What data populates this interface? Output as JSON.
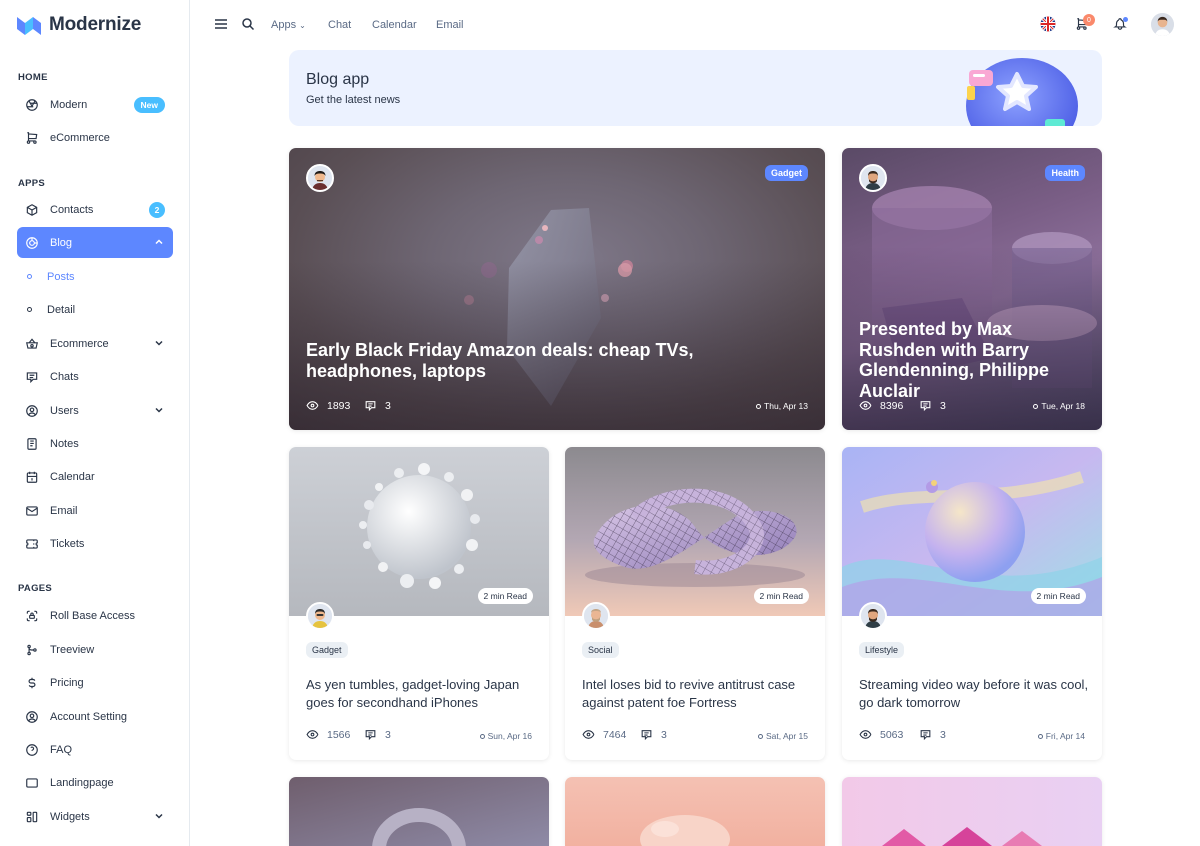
{
  "app": {
    "name": "Modernize"
  },
  "sidebar": {
    "sections": [
      "HOME",
      "APPS",
      "PAGES"
    ],
    "items": [
      {
        "label": "Modern",
        "icon": "aperture-icon",
        "badge": "New"
      },
      {
        "label": "eCommerce",
        "icon": "shopping-cart-icon"
      },
      {
        "label": "Contacts",
        "icon": "box-icon",
        "badge": "2"
      },
      {
        "label": "Blog",
        "icon": "chart-donut-icon",
        "active": true
      },
      {
        "label": "Posts",
        "sub": true,
        "current": true
      },
      {
        "label": "Detail",
        "sub": true
      },
      {
        "label": "Ecommerce",
        "icon": "basket-icon"
      },
      {
        "label": "Chats",
        "icon": "message-icon"
      },
      {
        "label": "Users",
        "icon": "user-circle-icon"
      },
      {
        "label": "Notes",
        "icon": "notes-icon"
      },
      {
        "label": "Calendar",
        "icon": "calendar-icon"
      },
      {
        "label": "Email",
        "icon": "mail-icon"
      },
      {
        "label": "Tickets",
        "icon": "ticket-icon"
      },
      {
        "label": "Roll Base Access",
        "icon": "lock-access-icon"
      },
      {
        "label": "Treeview",
        "icon": "git-merge-icon"
      },
      {
        "label": "Pricing",
        "icon": "currency-dollar-icon"
      },
      {
        "label": "Account Setting",
        "icon": "user-circle-icon"
      },
      {
        "label": "FAQ",
        "icon": "help-icon"
      },
      {
        "label": "Landingpage",
        "icon": "app-window-icon"
      },
      {
        "label": "Widgets",
        "icon": "layout-icon"
      }
    ]
  },
  "header": {
    "links": [
      "Apps",
      "Chat",
      "Calendar",
      "Email"
    ],
    "cart_count": "0"
  },
  "banner": {
    "title": "Blog app",
    "subtitle": "Get the latest news"
  },
  "posts": [
    {
      "title": "Early Black Friday Amazon deals: cheap TVs, headphones, laptops",
      "category": "Gadget",
      "views": "1893",
      "comments": "3",
      "date": "Thu, Apr 13"
    },
    {
      "title": "Presented by Max Rushden with Barry Glendenning, Philippe Auclair",
      "category": "Health",
      "views": "8396",
      "comments": "3",
      "date": "Tue, Apr 18"
    },
    {
      "title": "As yen tumbles, gadget-loving Japan goes for secondhand iPhones",
      "category": "Gadget",
      "views": "1566",
      "comments": "3",
      "date": "Sun, Apr 16",
      "read": "2 min Read"
    },
    {
      "title": "Intel loses bid to revive antitrust case against patent foe Fortress",
      "category": "Social",
      "views": "7464",
      "comments": "3",
      "date": "Sat, Apr 15",
      "read": "2 min Read"
    },
    {
      "title": "Streaming video way before it was cool, go dark tomorrow",
      "category": "Lifestyle",
      "views": "5063",
      "comments": "3",
      "date": "Fri, Apr 14",
      "read": "2 min Read"
    }
  ],
  "colors": {
    "primary": "#5d87ff",
    "secondary": "#49beff",
    "text": "#2a3547",
    "banner_bg": "#ecf2ff"
  }
}
